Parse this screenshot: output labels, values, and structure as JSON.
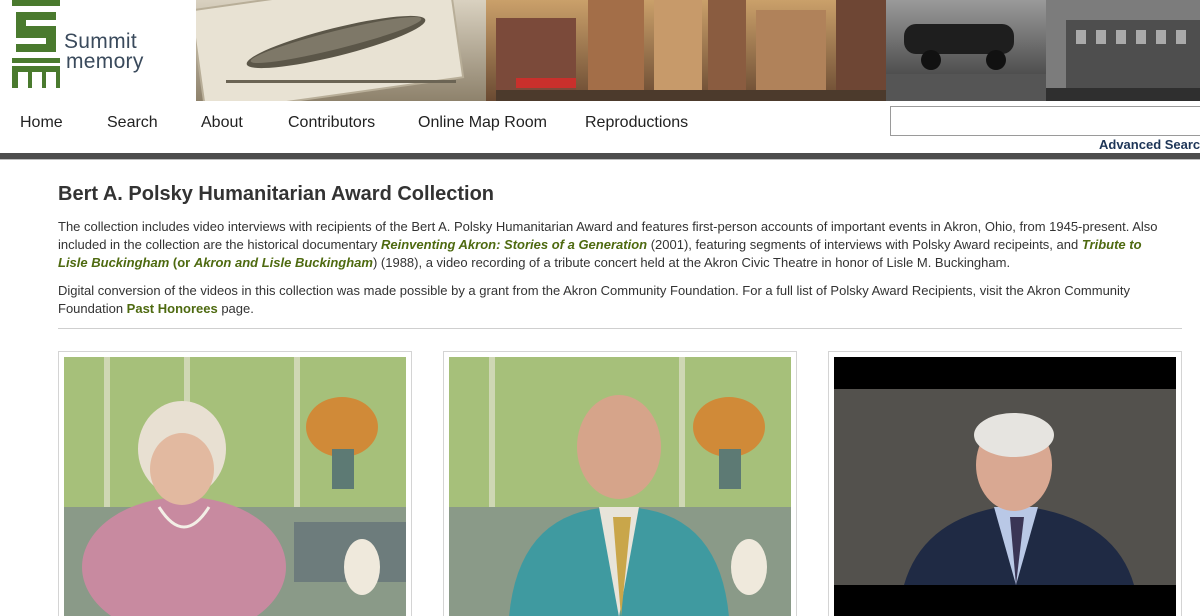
{
  "brand": {
    "line1": "Summit",
    "line2": "memory"
  },
  "nav": {
    "items": [
      {
        "label": "Home",
        "name": "nav-home"
      },
      {
        "label": "Search",
        "name": "nav-search"
      },
      {
        "label": "About",
        "name": "nav-about"
      },
      {
        "label": "Contributors",
        "name": "nav-contributors"
      },
      {
        "label": "Online Map Room",
        "name": "nav-online-map-room"
      },
      {
        "label": "Reproductions",
        "name": "nav-reproductions"
      }
    ],
    "search_value": "",
    "advanced_search": "Advanced Search"
  },
  "page": {
    "title": "Bert A. Polsky Humanitarian Award Collection",
    "p1": {
      "t1": "The collection includes video interviews with recipients of the Bert A. Polsky Humanitarian Award and features first-person accounts of important events in Akron, Ohio, from 1945-present. Also included in the collection are the historical documentary ",
      "link1": "Reinventing Akron: Stories of a Generation",
      "t2": " (2001), featuring segments of interviews with Polsky Award recipeints, and ",
      "link2": "Tribute to Lisle Buckingham",
      "t3": " (or ",
      "link3": "Akron and Lisle Buckingham",
      "t4": ") (1988), a video recording of a tribute concert held at the Akron Civic Theatre in honor of Lisle M. Buckingham."
    },
    "p2": {
      "t1": "Digital conversion of the videos in this collection was made possible by a grant from the Akron Community Foundation. For a full list of Polsky Award Recipients, visit the Akron Community Foundation ",
      "link1": "Past Honorees",
      "t2": " page."
    }
  },
  "colors": {
    "link_green": "#4e6a10",
    "nav_rule": "#4d4d4d",
    "title_text": "#333333"
  }
}
